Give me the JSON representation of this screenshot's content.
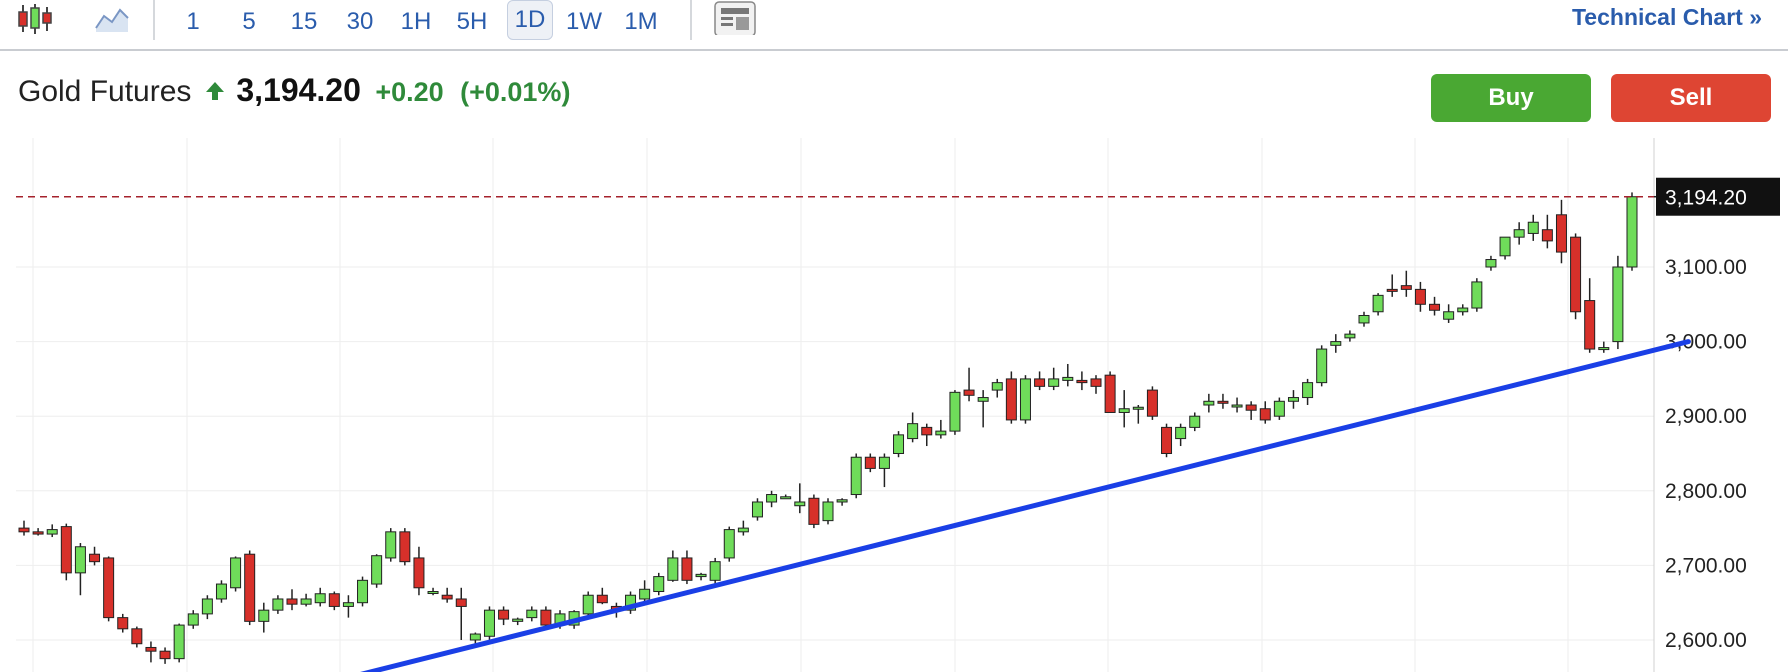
{
  "toolbar": {
    "chart_type_icons": [
      "candlestick-icon",
      "area-chart-icon"
    ],
    "timeframes": [
      {
        "label": "1",
        "active": false
      },
      {
        "label": "5",
        "active": false
      },
      {
        "label": "15",
        "active": false
      },
      {
        "label": "30",
        "active": false
      },
      {
        "label": "1H",
        "active": false
      },
      {
        "label": "5H",
        "active": false
      },
      {
        "label": "1D",
        "active": true
      },
      {
        "label": "1W",
        "active": false
      },
      {
        "label": "1M",
        "active": false
      }
    ],
    "layout_icon": "layout-icon",
    "technical_chart_link": "Technical Chart »"
  },
  "instrument": {
    "name": "Gold Futures",
    "direction_icon": "arrow-up-icon",
    "price": "3,194.20",
    "change": "+0.20",
    "change_pct": "(+0.01%)"
  },
  "actions": {
    "buy_label": "Buy",
    "sell_label": "Sell"
  },
  "colors": {
    "up": "#6fdc5a",
    "down": "#d7302a",
    "buy": "#4aa833",
    "sell": "#de4533",
    "trendline": "#1a3fe6",
    "link": "#2a5cac"
  },
  "chart_data": {
    "type": "candlestick",
    "y_ticks": [
      "3,100.00",
      "3,000.00",
      "2,900.00",
      "2,800.00",
      "2,700.00",
      "2,600.00"
    ],
    "y_tick_values": [
      3100,
      3000,
      2900,
      2800,
      2700,
      2600
    ],
    "ylim": [
      2560,
      3270
    ],
    "last_price": 3194.2,
    "last_price_label": "3,194.20",
    "trendline": {
      "start": [
        22,
        2545
      ],
      "end": [
        118,
        3000
      ]
    },
    "grid": true,
    "candles": [
      [
        2750,
        2760,
        2740,
        2745
      ],
      [
        2745,
        2750,
        2740,
        2742
      ],
      [
        2742,
        2755,
        2738,
        2748
      ],
      [
        2752,
        2756,
        2680,
        2690
      ],
      [
        2690,
        2730,
        2660,
        2725
      ],
      [
        2715,
        2725,
        2700,
        2705
      ],
      [
        2710,
        2712,
        2625,
        2630
      ],
      [
        2630,
        2635,
        2610,
        2615
      ],
      [
        2615,
        2618,
        2590,
        2595
      ],
      [
        2590,
        2598,
        2570,
        2585
      ],
      [
        2585,
        2590,
        2568,
        2575
      ],
      [
        2575,
        2622,
        2570,
        2620
      ],
      [
        2620,
        2640,
        2615,
        2635
      ],
      [
        2635,
        2660,
        2628,
        2655
      ],
      [
        2655,
        2680,
        2650,
        2675
      ],
      [
        2670,
        2712,
        2665,
        2710
      ],
      [
        2715,
        2720,
        2620,
        2625
      ],
      [
        2625,
        2650,
        2610,
        2640
      ],
      [
        2640,
        2660,
        2635,
        2655
      ],
      [
        2655,
        2668,
        2640,
        2648
      ],
      [
        2648,
        2662,
        2645,
        2655
      ],
      [
        2650,
        2670,
        2645,
        2662
      ],
      [
        2662,
        2665,
        2640,
        2645
      ],
      [
        2645,
        2660,
        2630,
        2650
      ],
      [
        2650,
        2685,
        2645,
        2680
      ],
      [
        2675,
        2715,
        2670,
        2713
      ],
      [
        2710,
        2750,
        2705,
        2745
      ],
      [
        2745,
        2750,
        2700,
        2705
      ],
      [
        2710,
        2725,
        2660,
        2670
      ],
      [
        2665,
        2670,
        2660,
        2665
      ],
      [
        2660,
        2670,
        2650,
        2655
      ],
      [
        2655,
        2670,
        2600,
        2645
      ],
      [
        2600,
        2610,
        2595,
        2608
      ],
      [
        2605,
        2645,
        2600,
        2640
      ],
      [
        2640,
        2645,
        2620,
        2628
      ],
      [
        2625,
        2630,
        2620,
        2628
      ],
      [
        2630,
        2645,
        2625,
        2640
      ],
      [
        2640,
        2645,
        2615,
        2620
      ],
      [
        2620,
        2640,
        2615,
        2635
      ],
      [
        2620,
        2640,
        2615,
        2638
      ],
      [
        2635,
        2665,
        2630,
        2660
      ],
      [
        2660,
        2670,
        2648,
        2650
      ],
      [
        2645,
        2650,
        2630,
        2640
      ],
      [
        2640,
        2665,
        2635,
        2660
      ],
      [
        2655,
        2680,
        2650,
        2668
      ],
      [
        2665,
        2690,
        2660,
        2685
      ],
      [
        2680,
        2720,
        2678,
        2710
      ],
      [
        2710,
        2720,
        2675,
        2680
      ],
      [
        2685,
        2690,
        2680,
        2688
      ],
      [
        2680,
        2710,
        2675,
        2705
      ],
      [
        2710,
        2752,
        2705,
        2748
      ],
      [
        2745,
        2760,
        2740,
        2750
      ],
      [
        2765,
        2790,
        2760,
        2785
      ],
      [
        2785,
        2800,
        2778,
        2795
      ],
      [
        2790,
        2795,
        2790,
        2792
      ],
      [
        2780,
        2810,
        2770,
        2785
      ],
      [
        2790,
        2795,
        2750,
        2755
      ],
      [
        2760,
        2790,
        2755,
        2785
      ],
      [
        2785,
        2790,
        2780,
        2788
      ],
      [
        2795,
        2850,
        2790,
        2845
      ],
      [
        2845,
        2850,
        2825,
        2830
      ],
      [
        2830,
        2850,
        2805,
        2845
      ],
      [
        2850,
        2880,
        2845,
        2875
      ],
      [
        2870,
        2905,
        2865,
        2890
      ],
      [
        2885,
        2890,
        2860,
        2875
      ],
      [
        2875,
        2895,
        2870,
        2880
      ],
      [
        2880,
        2935,
        2875,
        2932
      ],
      [
        2935,
        2965,
        2920,
        2928
      ],
      [
        2920,
        2935,
        2885,
        2925
      ],
      [
        2935,
        2950,
        2925,
        2945
      ],
      [
        2950,
        2960,
        2890,
        2895
      ],
      [
        2895,
        2955,
        2890,
        2950
      ],
      [
        2950,
        2960,
        2935,
        2940
      ],
      [
        2940,
        2965,
        2935,
        2950
      ],
      [
        2948,
        2970,
        2940,
        2952
      ],
      [
        2948,
        2960,
        2935,
        2945
      ],
      [
        2950,
        2955,
        2930,
        2940
      ],
      [
        2955,
        2960,
        2910,
        2905
      ],
      [
        2905,
        2935,
        2885,
        2910
      ],
      [
        2910,
        2915,
        2890,
        2912
      ],
      [
        2935,
        2940,
        2895,
        2900
      ],
      [
        2885,
        2890,
        2845,
        2850
      ],
      [
        2870,
        2890,
        2860,
        2885
      ],
      [
        2885,
        2905,
        2880,
        2900
      ],
      [
        2915,
        2930,
        2905,
        2920
      ],
      [
        2920,
        2930,
        2910,
        2918
      ],
      [
        2915,
        2925,
        2905,
        2915
      ],
      [
        2915,
        2920,
        2895,
        2908
      ],
      [
        2910,
        2920,
        2890,
        2895
      ],
      [
        2900,
        2925,
        2895,
        2920
      ],
      [
        2920,
        2935,
        2910,
        2925
      ],
      [
        2925,
        2950,
        2915,
        2945
      ],
      [
        2945,
        2995,
        2940,
        2990
      ],
      [
        2995,
        3010,
        2985,
        3000
      ],
      [
        3005,
        3015,
        3000,
        3010
      ],
      [
        3025,
        3040,
        3020,
        3035
      ],
      [
        3040,
        3065,
        3035,
        3062
      ],
      [
        3070,
        3090,
        3060,
        3068
      ],
      [
        3075,
        3095,
        3060,
        3070
      ],
      [
        3070,
        3080,
        3040,
        3050
      ],
      [
        3050,
        3060,
        3035,
        3042
      ],
      [
        3030,
        3050,
        3025,
        3040
      ],
      [
        3040,
        3050,
        3035,
        3045
      ],
      [
        3045,
        3085,
        3040,
        3080
      ],
      [
        3100,
        3115,
        3095,
        3110
      ],
      [
        3115,
        3140,
        3110,
        3140
      ],
      [
        3140,
        3160,
        3130,
        3150
      ],
      [
        3145,
        3170,
        3135,
        3160
      ],
      [
        3150,
        3170,
        3125,
        3135
      ],
      [
        3170,
        3190,
        3105,
        3120
      ],
      [
        3140,
        3145,
        3030,
        3040
      ],
      [
        3055,
        3085,
        2985,
        2990
      ],
      [
        2990,
        3000,
        2985,
        2992
      ],
      [
        3000,
        3115,
        2990,
        3100
      ],
      [
        3100,
        3200,
        3095,
        3194.2
      ]
    ]
  }
}
